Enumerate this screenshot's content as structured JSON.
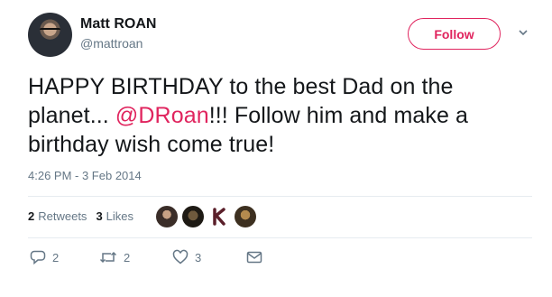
{
  "user": {
    "name": "Matt ROAN",
    "handle": "@mattroan",
    "follow_label": "Follow"
  },
  "tweet": {
    "text_before": "HAPPY BIRTHDAY to the best Dad on the planet... ",
    "mention": "@DRoan",
    "text_after": "!!!  Follow him and make a birthday wish come true!",
    "timestamp": "4:26 PM - 3 Feb 2014"
  },
  "stats": {
    "retweets_count": "2",
    "retweets_label": "Retweets",
    "likes_count": "3",
    "likes_label": "Likes"
  },
  "actions": {
    "reply_count": "2",
    "retweet_count": "2",
    "like_count": "3"
  },
  "colors": {
    "accent": "#e0245e",
    "muted": "#657786",
    "text": "#14171a",
    "divider": "#e6ecf0"
  },
  "icons": [
    "chevron-down-icon",
    "reply-icon",
    "retweet-icon",
    "heart-icon",
    "direct-message-icon"
  ]
}
